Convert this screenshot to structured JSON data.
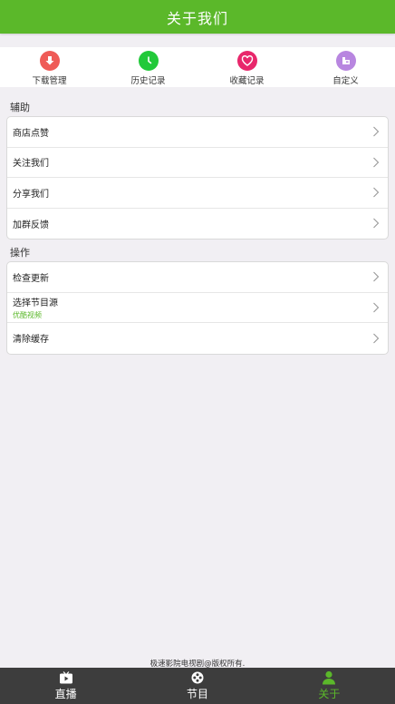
{
  "header": {
    "title": "关于我们"
  },
  "quick": [
    {
      "label": "下载管理",
      "icon": "download-icon",
      "color": "#ef5b57"
    },
    {
      "label": "历史记录",
      "icon": "clock-icon",
      "color": "#22c93a"
    },
    {
      "label": "收藏记录",
      "icon": "heart-icon",
      "color": "#e8276b"
    },
    {
      "label": "自定义",
      "icon": "custom-icon",
      "color": "#b886e0"
    }
  ],
  "sections": {
    "assist": {
      "title": "辅助",
      "items": [
        {
          "label": "商店点赞"
        },
        {
          "label": "关注我们"
        },
        {
          "label": "分享我们"
        },
        {
          "label": "加群反馈"
        }
      ]
    },
    "ops": {
      "title": "操作",
      "items": [
        {
          "label": "检查更新"
        },
        {
          "label": "选择节目源",
          "sub": "优酷视频"
        },
        {
          "label": "清除缓存"
        }
      ]
    }
  },
  "footer": {
    "copyright": "极速影院电视剧@版权所有."
  },
  "tabs": [
    {
      "label": "直播",
      "icon": "tv-icon"
    },
    {
      "label": "节目",
      "icon": "film-reel-icon"
    },
    {
      "label": "关于",
      "icon": "person-icon",
      "active": true
    }
  ],
  "colors": {
    "accent": "#5bb82a",
    "tabbar": "#3d3d3d"
  }
}
